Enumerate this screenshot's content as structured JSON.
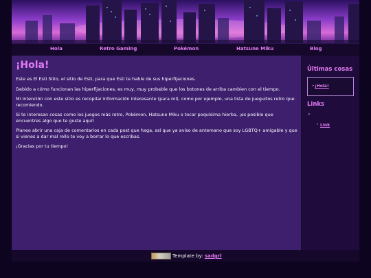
{
  "nav": {
    "items": [
      "Hola",
      "Retro Gaming",
      "Pokémon",
      "Hatsune Miku",
      "Blog"
    ]
  },
  "main": {
    "title": "¡Hola!",
    "paragraphs": [
      "Este es El Esti Sitio, el sitio de Esti, para que Esti te hable de sus hiperfijaciones.",
      "Debido a cómo funcionan las hiperfijaciones, es muy, muy probable que los botones de arriba cambien con el tiempo.",
      "Mi intención con este sitio es recopilar información interesante (para mí), como por ejemplo, una lista de jueguitos retro que recomiendo.",
      "Si te interesan cosas como los juegos más retro, Pokémon, Hatsune Miku o tocar poquísima hierba, ¡es posible que encuentres algo que te guste aquí!",
      "Planeo abrir una caja de comentarios en cada post que haga, así que ya aviso de antemano que soy LGBTQ+ amigable y que si vienes a dar mal rollo te voy a borrar lo que escribas.",
      "¡Gracias por tu tiempo!"
    ]
  },
  "sidebar": {
    "recent_title": "Últimas cosas",
    "recent_items": [
      "¡Hola!"
    ],
    "links_title": "Links",
    "links_bullet": "»",
    "links_items": [
      "Link"
    ]
  },
  "footer": {
    "prefix": "Template by:",
    "author": "sadgrl"
  },
  "colors": {
    "accent": "#e27cf2",
    "main_bg": "#3d1f6e",
    "sidebar_bg": "#1f0c3c",
    "page_bg": "#0d0520"
  }
}
